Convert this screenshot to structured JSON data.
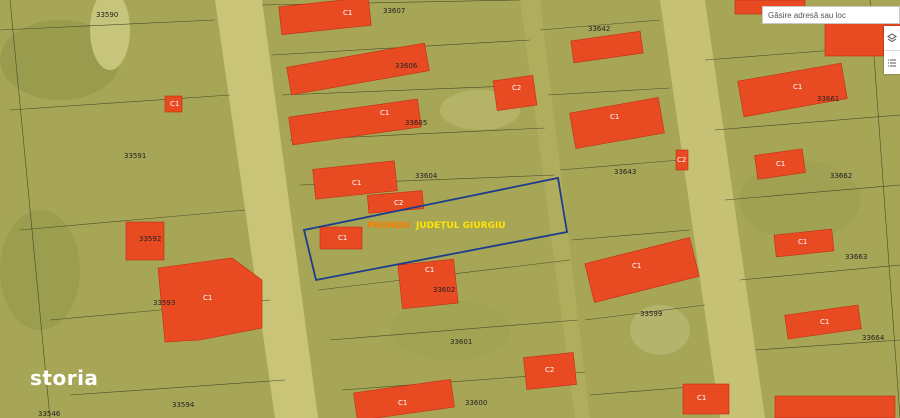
{
  "search": {
    "placeholder": "Găsire adresă sau loc"
  },
  "controls": [
    {
      "icon": "layers-icon"
    },
    {
      "icon": "list-icon"
    }
  ],
  "brand": "storia",
  "selection": {
    "locality": "PRUNDU",
    "county": "JUDEȚUL GIURGIU",
    "color": "#1e3c8c"
  },
  "parcels": [
    "33590",
    "33607",
    "33606",
    "33605",
    "33604",
    "33591",
    "33592",
    "33593",
    "33546",
    "33594",
    "33601",
    "33602",
    "33600",
    "33599",
    "33642",
    "33643",
    "33661",
    "33662",
    "33663",
    "33664"
  ],
  "buildings": [
    "C1",
    "C2"
  ],
  "colors": {
    "building": "#e84a22",
    "background": "#a9a95a",
    "road": "#c9c477"
  }
}
